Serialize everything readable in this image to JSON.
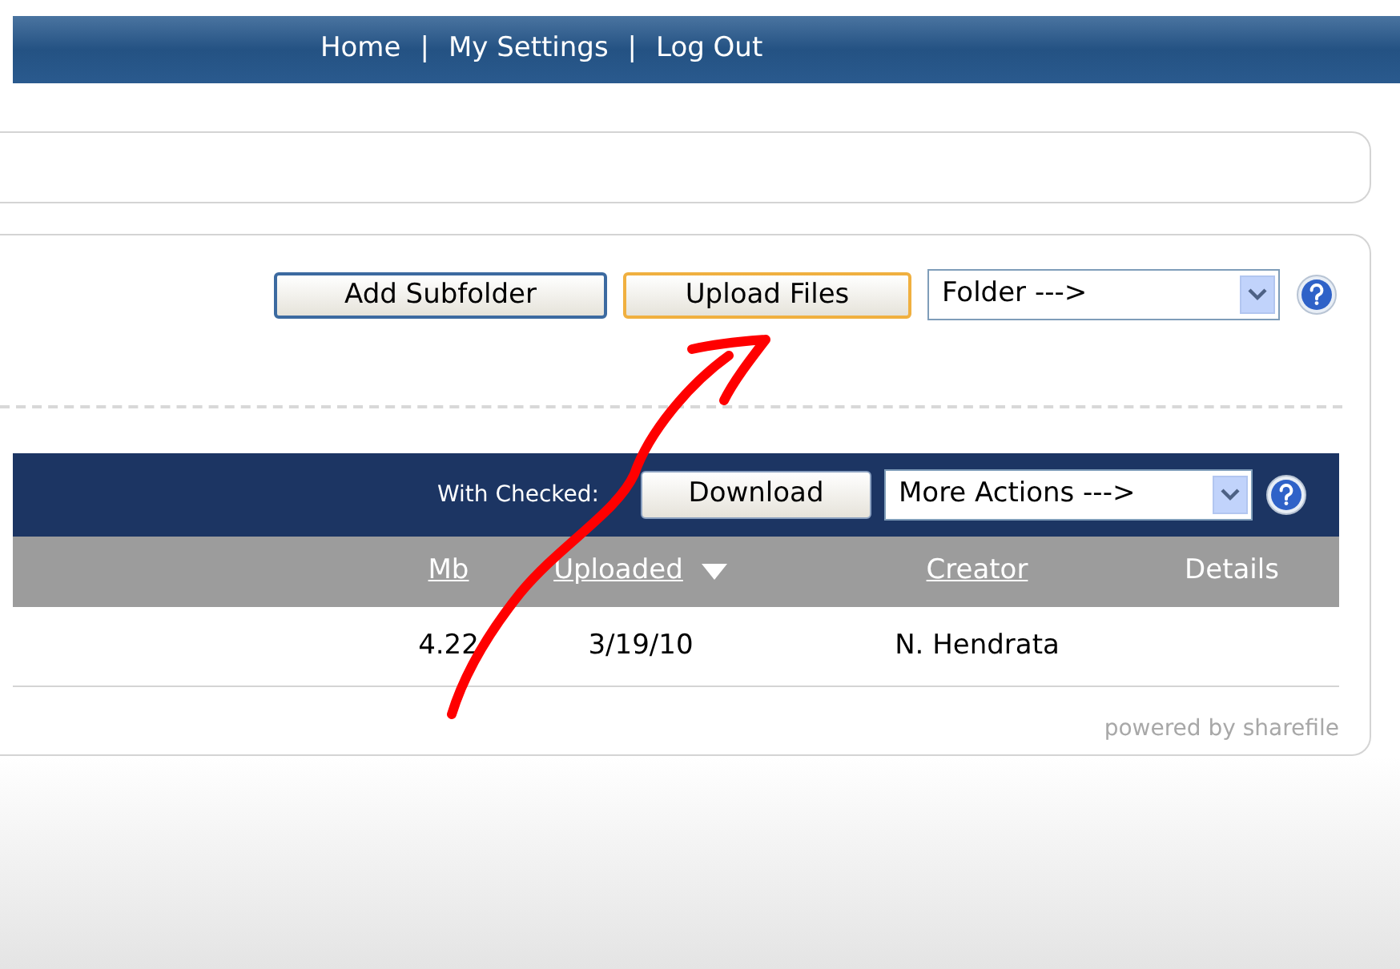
{
  "top_nav": {
    "links": [
      "Home",
      "My Settings",
      "Log Out"
    ],
    "separator": "|"
  },
  "toolbar": {
    "buttons": [
      {
        "label": "Add Subfolder",
        "highlighted": false
      },
      {
        "label": "Upload Files",
        "highlighted": true
      }
    ],
    "folder_select": "Folder --->"
  },
  "action_bar": {
    "label": "With Checked:",
    "button": "Download",
    "select": "More Actions --->"
  },
  "table": {
    "columns": [
      {
        "label": "Mb",
        "link": true,
        "sorted": false
      },
      {
        "label": "Uploaded",
        "link": true,
        "sorted": true
      },
      {
        "label": "Creator",
        "link": true,
        "sorted": false
      },
      {
        "label": "Details",
        "link": false,
        "sorted": false
      }
    ],
    "rows": [
      [
        "4.22",
        "3/19/10",
        "N. Hendrata",
        ""
      ]
    ]
  },
  "footer": "powered by sharefile"
}
